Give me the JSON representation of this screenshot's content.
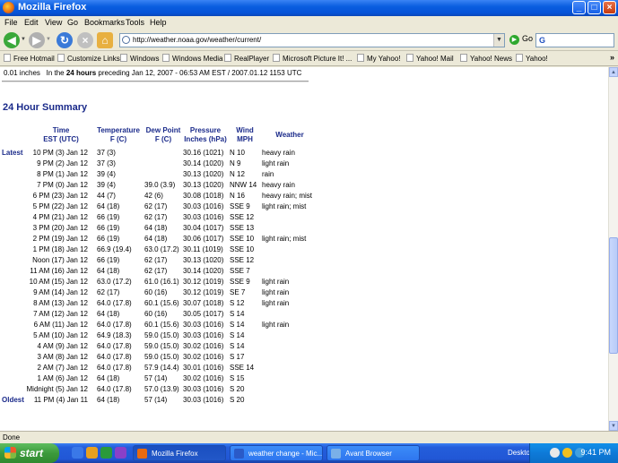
{
  "window": {
    "title": "Mozilla Firefox"
  },
  "menu": [
    "File",
    "Edit",
    "View",
    "Go",
    "Bookmarks",
    "Tools",
    "Help"
  ],
  "address": {
    "url": "http://weather.noaa.gov/weather/current/",
    "go_label": "Go",
    "search_value": "G"
  },
  "bookmarks": [
    "Free Hotmail",
    "Customize Links",
    "Windows",
    "Windows Media",
    "RealPlayer",
    "Microsoft Picture It! ...",
    "My Yahoo!",
    "Yahoo! Mail",
    "Yahoo! News",
    "Yahoo!"
  ],
  "page": {
    "precip_value": "0.01 inches",
    "precip_text_a": "In the",
    "precip_text_bold": "24 hours",
    "precip_text_b": "preceding Jan 12, 2007 - 06:53 AM EST / 2007.01.12 1153 UTC",
    "section_title": "24 Hour Summary",
    "headers": {
      "time": [
        "Time",
        "EST (UTC)"
      ],
      "temp": [
        "Temperature",
        "F (C)"
      ],
      "dew": [
        "Dew Point",
        "F (C)"
      ],
      "pressure": [
        "Pressure",
        "Inches (hPa)"
      ],
      "wind": [
        "Wind",
        "MPH"
      ],
      "weather": "Weather"
    },
    "label_latest": "Latest",
    "label_oldest": "Oldest",
    "rows": [
      {
        "time": "10 PM (3) Jan 12",
        "temp": "37 (3)",
        "dew": "",
        "pressure": "30.16 (1021)",
        "wind": "N 10",
        "weather": "heavy rain"
      },
      {
        "time": "9 PM (2) Jan 12",
        "temp": "37 (3)",
        "dew": "",
        "pressure": "30.14 (1020)",
        "wind": "N 9",
        "weather": "light rain"
      },
      {
        "time": "8 PM (1) Jan 12",
        "temp": "39 (4)",
        "dew": "",
        "pressure": "30.13 (1020)",
        "wind": "N 12",
        "weather": "rain"
      },
      {
        "time": "7 PM (0) Jan 12",
        "temp": "39 (4)",
        "dew": "39.0 (3.9)",
        "pressure": "30.13 (1020)",
        "wind": "NNW 14",
        "weather": "heavy rain"
      },
      {
        "time": "6 PM (23) Jan 12",
        "temp": "44 (7)",
        "dew": "42 (6)",
        "pressure": "30.08 (1018)",
        "wind": "N 16",
        "weather": "heavy rain; mist"
      },
      {
        "time": "5 PM (22) Jan 12",
        "temp": "64 (18)",
        "dew": "62 (17)",
        "pressure": "30.03 (1016)",
        "wind": "SSE 9",
        "weather": "light rain; mist"
      },
      {
        "time": "4 PM (21) Jan 12",
        "temp": "66 (19)",
        "dew": "62 (17)",
        "pressure": "30.03 (1016)",
        "wind": "SSE 12",
        "weather": ""
      },
      {
        "time": "3 PM (20) Jan 12",
        "temp": "66 (19)",
        "dew": "64 (18)",
        "pressure": "30.04 (1017)",
        "wind": "SSE 13",
        "weather": ""
      },
      {
        "time": "2 PM (19) Jan 12",
        "temp": "66 (19)",
        "dew": "64 (18)",
        "pressure": "30.06 (1017)",
        "wind": "SSE 10",
        "weather": "light rain; mist"
      },
      {
        "time": "1 PM (18) Jan 12",
        "temp": "66.9 (19.4)",
        "dew": "63.0 (17.2)",
        "pressure": "30.11 (1019)",
        "wind": "SSE 10",
        "weather": ""
      },
      {
        "time": "Noon (17) Jan 12",
        "temp": "66 (19)",
        "dew": "62 (17)",
        "pressure": "30.13 (1020)",
        "wind": "SSE 12",
        "weather": ""
      },
      {
        "time": "11 AM (16) Jan 12",
        "temp": "64 (18)",
        "dew": "62 (17)",
        "pressure": "30.14 (1020)",
        "wind": "SSE 7",
        "weather": ""
      },
      {
        "time": "10 AM (15) Jan 12",
        "temp": "63.0 (17.2)",
        "dew": "61.0 (16.1)",
        "pressure": "30.12 (1019)",
        "wind": "SSE 9",
        "weather": "light rain"
      },
      {
        "time": "9 AM (14) Jan 12",
        "temp": "62 (17)",
        "dew": "60 (16)",
        "pressure": "30.12 (1019)",
        "wind": "SE 7",
        "weather": "light rain"
      },
      {
        "time": "8 AM (13) Jan 12",
        "temp": "64.0 (17.8)",
        "dew": "60.1 (15.6)",
        "pressure": "30.07 (1018)",
        "wind": "S 12",
        "weather": "light rain"
      },
      {
        "time": "7 AM (12) Jan 12",
        "temp": "64 (18)",
        "dew": "60 (16)",
        "pressure": "30.05 (1017)",
        "wind": "S 14",
        "weather": ""
      },
      {
        "time": "6 AM (11) Jan 12",
        "temp": "64.0 (17.8)",
        "dew": "60.1 (15.6)",
        "pressure": "30.03 (1016)",
        "wind": "S 14",
        "weather": "light rain"
      },
      {
        "time": "5 AM (10) Jan 12",
        "temp": "64.9 (18.3)",
        "dew": "59.0 (15.0)",
        "pressure": "30.03 (1016)",
        "wind": "S 14",
        "weather": ""
      },
      {
        "time": "4 AM (9) Jan 12",
        "temp": "64.0 (17.8)",
        "dew": "59.0 (15.0)",
        "pressure": "30.02 (1016)",
        "wind": "S 14",
        "weather": ""
      },
      {
        "time": "3 AM (8) Jan 12",
        "temp": "64.0 (17.8)",
        "dew": "59.0 (15.0)",
        "pressure": "30.02 (1016)",
        "wind": "S 17",
        "weather": ""
      },
      {
        "time": "2 AM (7) Jan 12",
        "temp": "64.0 (17.8)",
        "dew": "57.9 (14.4)",
        "pressure": "30.01 (1016)",
        "wind": "SSE 14",
        "weather": ""
      },
      {
        "time": "1 AM (6) Jan 12",
        "temp": "64 (18)",
        "dew": "57 (14)",
        "pressure": "30.02 (1016)",
        "wind": "S 15",
        "weather": ""
      },
      {
        "time": "Midnight (5) Jan 12",
        "temp": "64.0 (17.8)",
        "dew": "57.0 (13.9)",
        "pressure": "30.03 (1016)",
        "wind": "S 20",
        "weather": ""
      },
      {
        "time": "11 PM (4) Jan 11",
        "temp": "64 (18)",
        "dew": "57 (14)",
        "pressure": "30.03 (1016)",
        "wind": "S 20",
        "weather": ""
      }
    ]
  },
  "status": "Done",
  "taskbar": {
    "start": "start",
    "tasks": [
      "Mozilla Firefox",
      "weather change - Mic...",
      "Avant Browser"
    ],
    "desktop_label": "Desktop",
    "clock": "9:41 PM"
  },
  "colors": {
    "header_text": "#1a2a8a",
    "titlebar": "#0553d8",
    "taskbar": "#245edb"
  }
}
